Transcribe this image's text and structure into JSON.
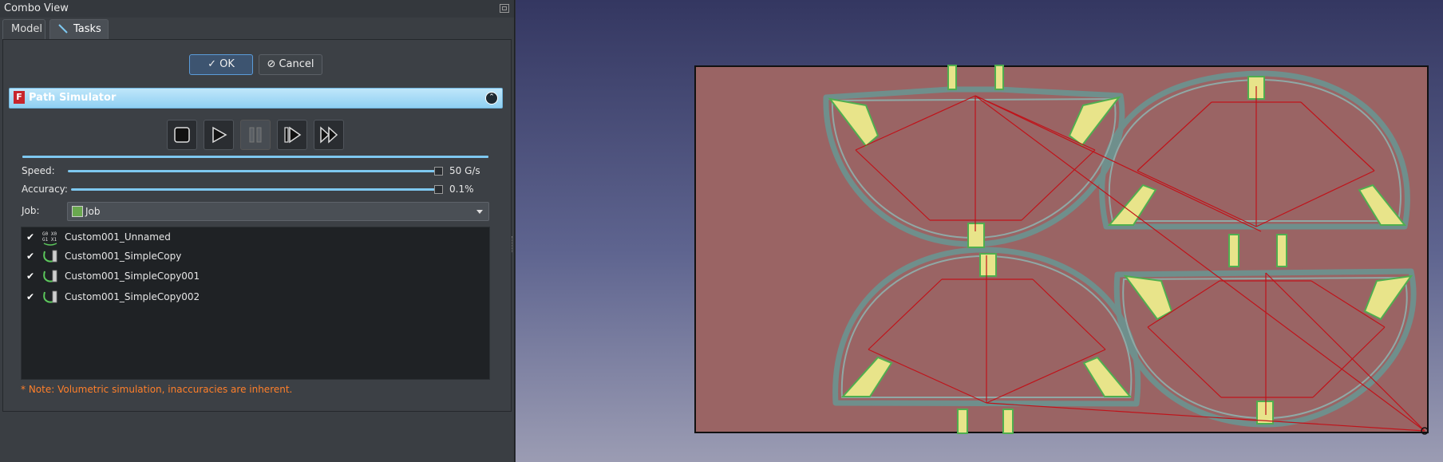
{
  "combo_view": {
    "title": "Combo View",
    "tabs": [
      {
        "label": "Model"
      },
      {
        "label": "Tasks"
      }
    ]
  },
  "dialog": {
    "ok_label": "OK",
    "cancel_label": "Cancel"
  },
  "simulator": {
    "title": "Path Simulator",
    "controls": [
      "stop-icon",
      "play-icon",
      "pause-icon",
      "step-icon",
      "fast-forward-icon"
    ],
    "speed_label": "Speed:",
    "speed_value": "50 G/s",
    "accuracy_label": "Accuracy:",
    "accuracy_value": "0.1%",
    "job_label": "Job:",
    "job_value": "Job",
    "operations": [
      {
        "checked": "✔",
        "name": "Custom001_Unnamed",
        "icon": "gcode-icon"
      },
      {
        "checked": "✔",
        "name": "Custom001_SimpleCopy",
        "icon": "toolpath-icon"
      },
      {
        "checked": "✔",
        "name": "Custom001_SimpleCopy001",
        "icon": "toolpath-icon"
      },
      {
        "checked": "✔",
        "name": "Custom001_SimpleCopy002",
        "icon": "toolpath-icon"
      }
    ],
    "note": "* Note: Volumetric simulation, inaccuracies are inherent.",
    "gcode_icon_text": [
      "G0 X0",
      "G1 X1"
    ]
  },
  "colors": {
    "stock": "#9a6464",
    "toolpath_outline": "#6f8f8c",
    "rapid_moves": "#c0131a",
    "pocket_fill": "#e8e48a",
    "accent": "#7ec8f0"
  }
}
